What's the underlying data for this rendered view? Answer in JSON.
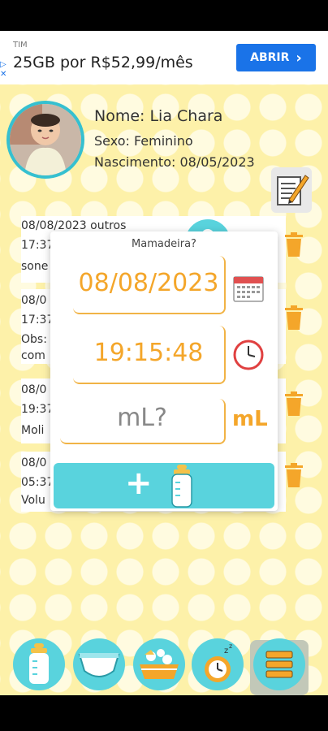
{
  "ad": {
    "brand": "TIM",
    "text": "25GB por R$52,99/mês",
    "button_label": "ABRIR",
    "button_chevron": "›"
  },
  "profile": {
    "name_line": "Nome: Lia Chara",
    "sex_line": "Sexo: Feminino",
    "birth_line": "Nascimento: 08/05/2023"
  },
  "records": [
    {
      "line1": "08/08/2023 outros",
      "line2": "17:37",
      "line3": "sone"
    },
    {
      "line1": "08/0",
      "line2": "17:37",
      "line3": "Obs:",
      "line4": "com"
    },
    {
      "line1": "08/0",
      "line2": "19:37",
      "line3": "Moli"
    },
    {
      "line1": "08/0",
      "line2": "05:37",
      "line3": "Volu"
    }
  ],
  "modal": {
    "title": "Mamadeira?",
    "date_value": "08/08/2023",
    "time_value": "19:15:48",
    "ml_placeholder": "mL?",
    "ml_unit": "mL",
    "add_symbol": "+"
  },
  "colors": {
    "accent_teal": "#59d3dd",
    "accent_orange": "#f4a62a",
    "background_yellow": "#fdf1a9",
    "ad_button_blue": "#1a73e8"
  },
  "icons": {
    "calendar": "calendar-icon",
    "clock": "clock-icon",
    "bottle": "bottle-icon",
    "trash": "trash-icon",
    "edit": "edit-icon"
  }
}
